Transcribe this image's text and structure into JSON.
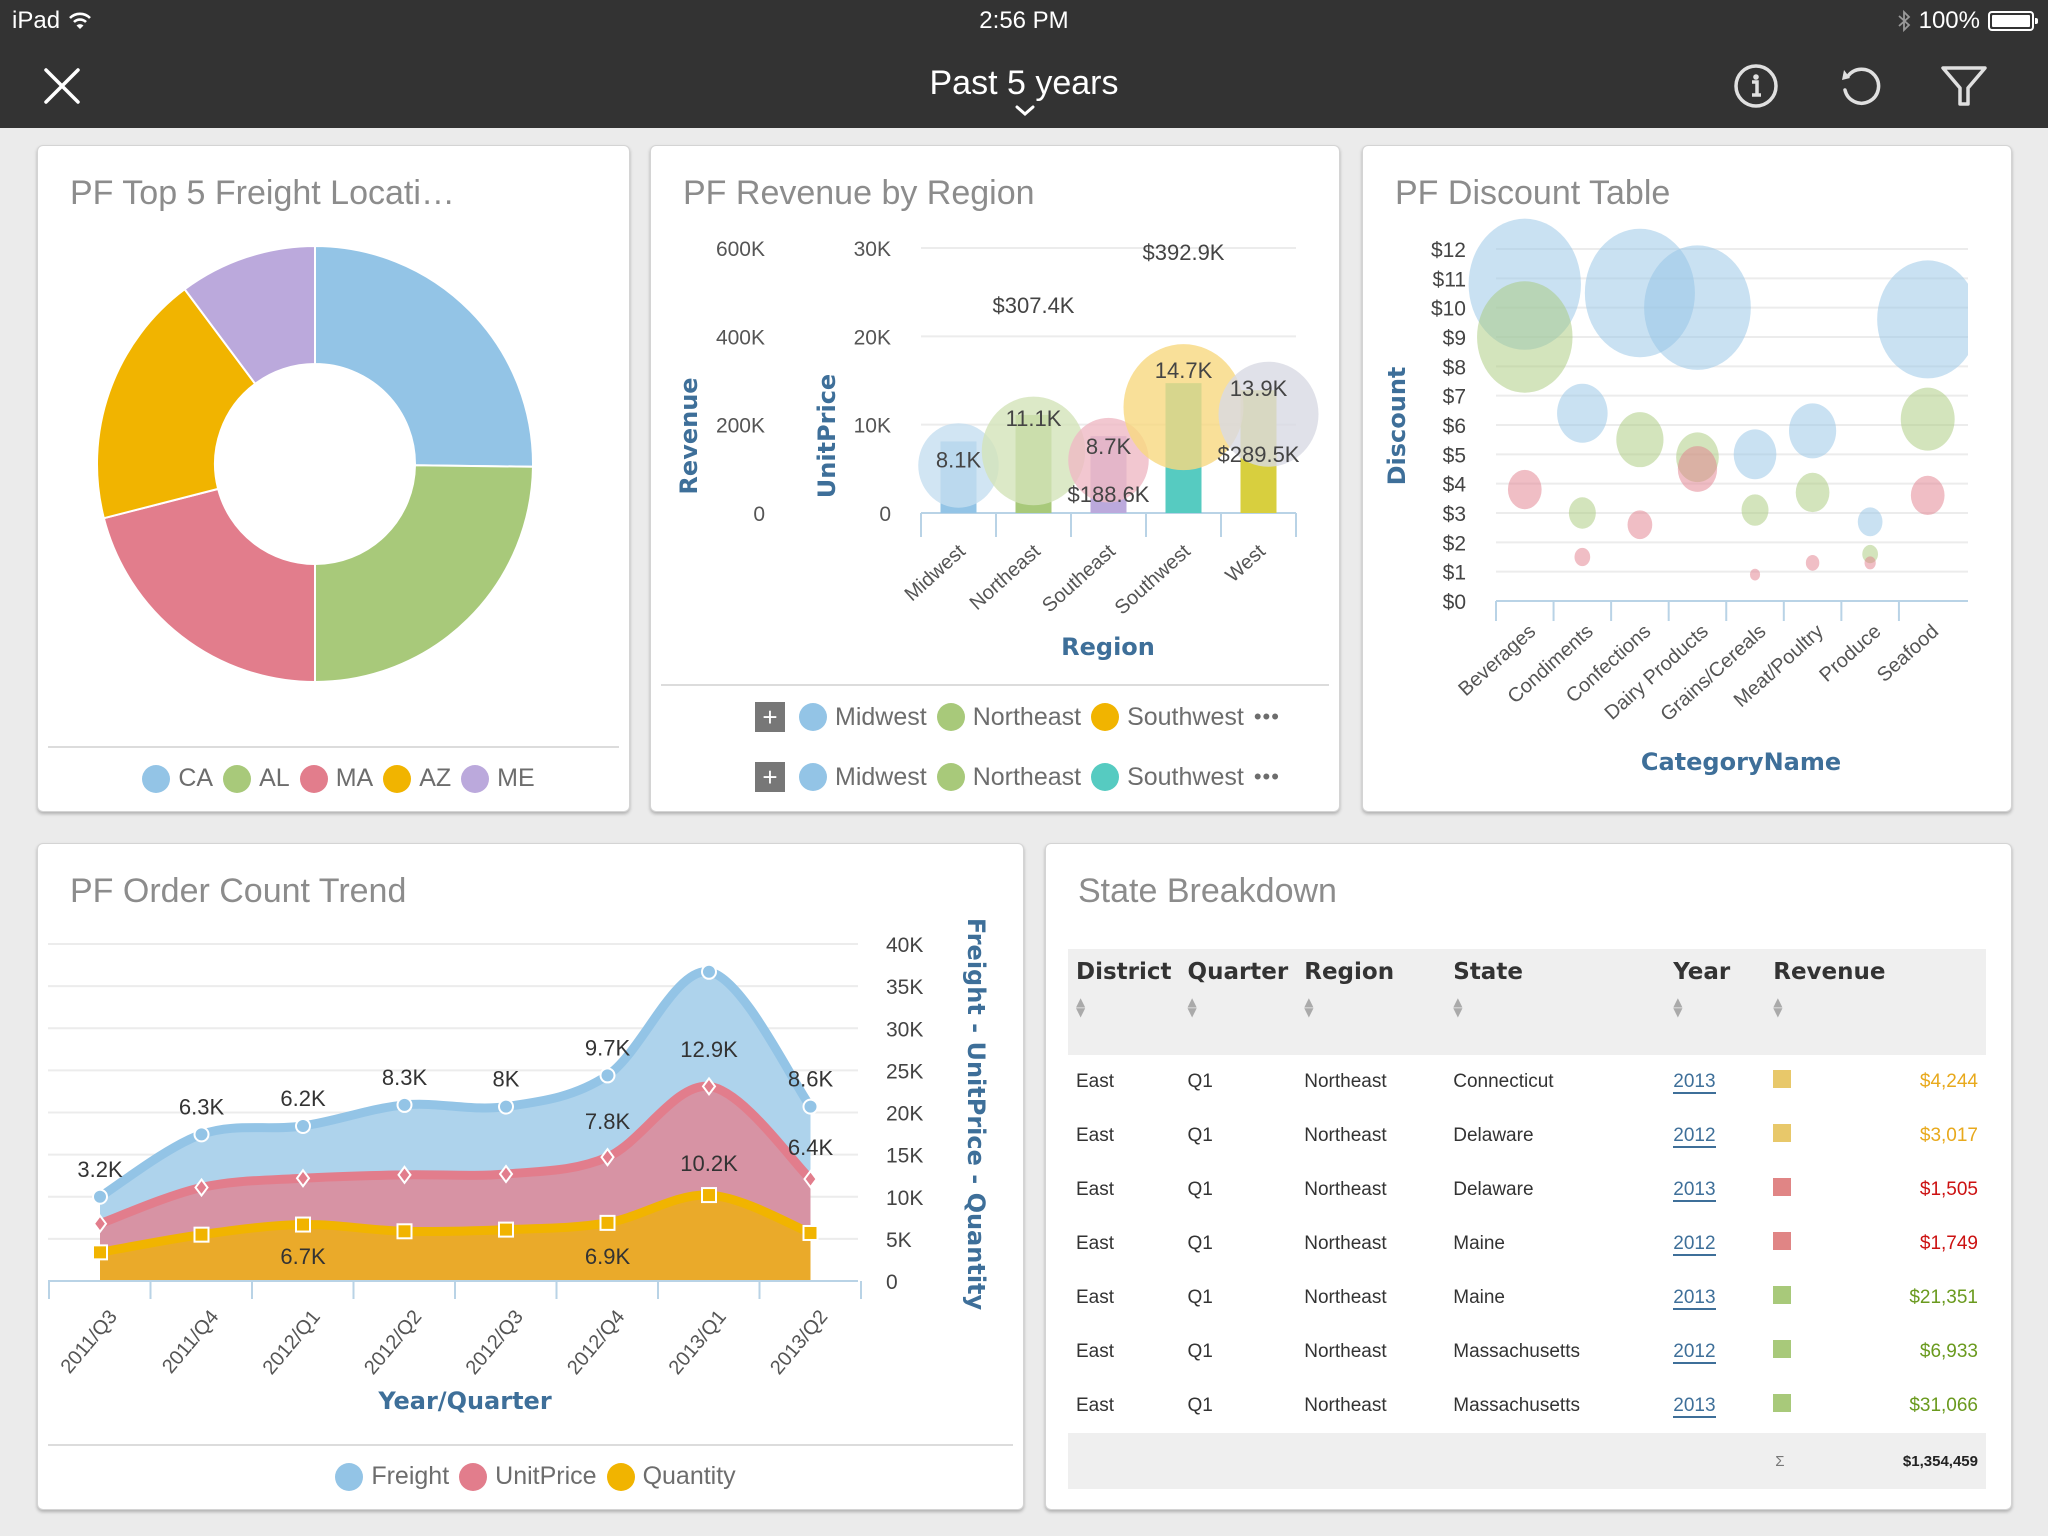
{
  "status_bar": {
    "device": "iPad",
    "time": "2:56 PM",
    "battery_percent": "100%",
    "battery_level": 1.0,
    "icons": [
      "wifi-icon",
      "bluetooth-icon",
      "battery-icon"
    ]
  },
  "nav": {
    "title": "Past 5 years",
    "icons": [
      "close-icon",
      "chevron-down-icon",
      "info-icon",
      "refresh-icon",
      "filter-icon"
    ]
  },
  "colors": {
    "blue": "#93c4e6",
    "green": "#a8c97a",
    "pink": "#e27d8c",
    "orange": "#f1b400",
    "purple": "#bba9dc",
    "teal": "#56cbc1",
    "olive": "#d8cf3e",
    "axis_title": "#3e6f99",
    "rev_orange": "#e8a91c",
    "rev_red": "#cc1111",
    "rev_green": "#6a9a1e"
  },
  "cards": {
    "freight": {
      "title": "PF Top 5 Freight Locati…",
      "legend": [
        {
          "label": "CA",
          "color": "#93c4e6"
        },
        {
          "label": "AL",
          "color": "#a8c97a"
        },
        {
          "label": "MA",
          "color": "#e27d8c"
        },
        {
          "label": "AZ",
          "color": "#f1b400"
        },
        {
          "label": "ME",
          "color": "#bba9dc"
        }
      ]
    },
    "revenue": {
      "title": "PF Revenue by Region",
      "legend_rows": [
        {
          "items": [
            {
              "label": "Midwest",
              "color": "#93c4e6"
            },
            {
              "label": "Northeast",
              "color": "#a8c97a"
            },
            {
              "label": "Southwest",
              "color": "#f1b400"
            }
          ],
          "more": "•••",
          "expand": "+"
        },
        {
          "items": [
            {
              "label": "Midwest",
              "color": "#93c4e6"
            },
            {
              "label": "Northeast",
              "color": "#a8c97a"
            },
            {
              "label": "Southwest",
              "color": "#56cbc1"
            }
          ],
          "more": "•••",
          "expand": "+"
        }
      ]
    },
    "discount": {
      "title": "PF Discount Table"
    },
    "order_trend": {
      "title": "PF Order Count Trend",
      "legend": [
        {
          "label": "Freight",
          "color": "#93c4e6"
        },
        {
          "label": "UnitPrice",
          "color": "#e27d8c"
        },
        {
          "label": "Quantity",
          "color": "#f1b400"
        }
      ]
    },
    "state": {
      "title": "State Breakdown",
      "columns": [
        "District",
        "Quarter",
        "Region",
        "State",
        "Year",
        "Revenue"
      ],
      "rows": [
        {
          "district": "East",
          "quarter": "Q1",
          "region": "Northeast",
          "state": "Connecticut",
          "year": "2013",
          "swatch": "#e8c86a",
          "revenue": "$4,244",
          "rev_color": "#e8a91c"
        },
        {
          "district": "East",
          "quarter": "Q1",
          "region": "Northeast",
          "state": "Delaware",
          "year": "2012",
          "swatch": "#e8c86a",
          "revenue": "$3,017",
          "rev_color": "#e8a91c"
        },
        {
          "district": "East",
          "quarter": "Q1",
          "region": "Northeast",
          "state": "Delaware",
          "year": "2013",
          "swatch": "#e08585",
          "revenue": "$1,505",
          "rev_color": "#cc1111"
        },
        {
          "district": "East",
          "quarter": "Q1",
          "region": "Northeast",
          "state": "Maine",
          "year": "2012",
          "swatch": "#e08585",
          "revenue": "$1,749",
          "rev_color": "#cc1111"
        },
        {
          "district": "East",
          "quarter": "Q1",
          "region": "Northeast",
          "state": "Maine",
          "year": "2013",
          "swatch": "#a8c97a",
          "revenue": "$21,351",
          "rev_color": "#6a9a1e"
        },
        {
          "district": "East",
          "quarter": "Q1",
          "region": "Northeast",
          "state": "Massachusetts",
          "year": "2012",
          "swatch": "#a8c97a",
          "revenue": "$6,933",
          "rev_color": "#6a9a1e"
        },
        {
          "district": "East",
          "quarter": "Q1",
          "region": "Northeast",
          "state": "Massachusetts",
          "year": "2013",
          "swatch": "#a8c97a",
          "revenue": "$31,066",
          "rev_color": "#6a9a1e"
        }
      ],
      "total_symbol": "Σ",
      "total": "$1,354,459"
    }
  },
  "chart_data": [
    {
      "id": "freight_donut",
      "type": "pie",
      "donut": true,
      "title": "PF Top 5 Freight Locati…",
      "categories": [
        "CA",
        "AL",
        "MA",
        "AZ",
        "ME"
      ],
      "values": [
        25.2,
        24.8,
        21.0,
        18.8,
        10.2
      ],
      "colors": [
        "#93c4e6",
        "#a8c97a",
        "#e27d8c",
        "#f1b400",
        "#bba9dc"
      ],
      "legend": "bottom"
    },
    {
      "id": "revenue_region",
      "type": "bar",
      "title": "PF Revenue by Region",
      "categories": [
        "Midwest",
        "Northeast",
        "Southeast",
        "Southwest",
        "West"
      ],
      "xlabel": "Region",
      "y_axes": [
        {
          "label": "Revenue",
          "ticks": [
            "0",
            "200K",
            "400K",
            "600K"
          ],
          "range": [
            0,
            600000
          ]
        },
        {
          "label": "UnitPrice",
          "ticks": [
            "0",
            "10K",
            "20K",
            "30K"
          ],
          "range": [
            0,
            30000
          ]
        }
      ],
      "series": [
        {
          "name": "UnitPrice (bars)",
          "values": [
            8100,
            11100,
            8700,
            14700,
            13900
          ],
          "labels": [
            "",
            "",
            "",
            "",
            ""
          ],
          "colors": [
            "#93c4e6",
            "#a8c97a",
            "#bba9dc",
            "#56cbc1",
            "#d8cf3e"
          ]
        },
        {
          "name": "Revenue (bubbles)",
          "values": [
            188600,
            307400,
            188600,
            392900,
            289500
          ],
          "bubble_values": [
            8100,
            11100,
            8700,
            14700,
            13900
          ],
          "bubble_labels": [
            "8.1K",
            "11.1K",
            "8.7K",
            "14.7K",
            "13.9K"
          ],
          "revenue_labels": [
            "",
            "$307.4K",
            "$188.6K",
            "$392.9K",
            "$289.5K"
          ],
          "colors": [
            "#c6dff0",
            "#d3e4b9",
            "#efb9c4",
            "#f7d880",
            "#d8dae4"
          ]
        }
      ],
      "legend": "bottom"
    },
    {
      "id": "discount_bubbles",
      "type": "scatter",
      "title": "PF Discount Table",
      "xlabel": "CategoryName",
      "ylabel": "Discount",
      "categories": [
        "Beverages",
        "Condiments",
        "Confections",
        "Dairy Products",
        "Grains/Cereals",
        "Meat/Poultry",
        "Produce",
        "Seafood"
      ],
      "y_ticks": [
        "$0",
        "$1",
        "$2",
        "$3",
        "$4",
        "$5",
        "$6",
        "$7",
        "$8",
        "$9",
        "$10",
        "$11",
        "$12"
      ],
      "ylim": [
        0,
        12
      ],
      "series": [
        {
          "name": "blue",
          "color": "#93c4e6",
          "points": [
            {
              "x": 0.5,
              "y": 10.8,
              "r": 1.0
            },
            {
              "x": 1.5,
              "y": 6.4,
              "r": 0.45
            },
            {
              "x": 2.5,
              "y": 10.5,
              "r": 0.98
            },
            {
              "x": 3.5,
              "y": 10.0,
              "r": 0.95
            },
            {
              "x": 4.5,
              "y": 5.0,
              "r": 0.38
            },
            {
              "x": 5.5,
              "y": 5.8,
              "r": 0.42
            },
            {
              "x": 6.5,
              "y": 2.7,
              "r": 0.22
            },
            {
              "x": 7.5,
              "y": 9.6,
              "r": 0.9
            }
          ]
        },
        {
          "name": "green",
          "color": "#a8c97a",
          "points": [
            {
              "x": 0.5,
              "y": 9.0,
              "r": 0.85
            },
            {
              "x": 1.5,
              "y": 3.0,
              "r": 0.24
            },
            {
              "x": 2.5,
              "y": 5.5,
              "r": 0.42
            },
            {
              "x": 3.5,
              "y": 4.9,
              "r": 0.38
            },
            {
              "x": 4.5,
              "y": 3.1,
              "r": 0.24
            },
            {
              "x": 5.5,
              "y": 3.7,
              "r": 0.3
            },
            {
              "x": 6.5,
              "y": 1.6,
              "r": 0.14
            },
            {
              "x": 7.5,
              "y": 6.2,
              "r": 0.48
            }
          ]
        },
        {
          "name": "pink",
          "color": "#e27d8c",
          "points": [
            {
              "x": 0.5,
              "y": 3.8,
              "r": 0.3
            },
            {
              "x": 1.5,
              "y": 1.5,
              "r": 0.14
            },
            {
              "x": 2.5,
              "y": 2.6,
              "r": 0.22
            },
            {
              "x": 3.5,
              "y": 4.5,
              "r": 0.35
            },
            {
              "x": 4.5,
              "y": 0.9,
              "r": 0.09
            },
            {
              "x": 5.5,
              "y": 1.3,
              "r": 0.12
            },
            {
              "x": 6.5,
              "y": 1.3,
              "r": 0.1
            },
            {
              "x": 7.5,
              "y": 3.6,
              "r": 0.3
            }
          ]
        }
      ]
    },
    {
      "id": "order_trend",
      "type": "area",
      "stacked": true,
      "title": "PF Order Count Trend",
      "xlabel": "Year/Quarter",
      "ylabel": "Freight - UnitPrice - Quantity",
      "categories": [
        "2011/Q3",
        "2011/Q4",
        "2012/Q1",
        "2012/Q2",
        "2012/Q3",
        "2012/Q4",
        "2013/Q1",
        "2013/Q2"
      ],
      "ylim": [
        0,
        40000
      ],
      "y_ticks": [
        "0",
        "5K",
        "10K",
        "15K",
        "20K",
        "25K",
        "30K",
        "35K",
        "40K"
      ],
      "series": [
        {
          "name": "Quantity",
          "color": "#f1b400",
          "fill": "#eaaa2a",
          "marker": "square",
          "values": [
            3400,
            5500,
            6700,
            5900,
            6100,
            6900,
            10200,
            5700
          ],
          "labels": [
            "",
            "",
            "6.7K",
            "",
            "",
            "6.9K",
            "10.2K",
            ""
          ]
        },
        {
          "name": "UnitPrice",
          "color": "#e27d8c",
          "fill": "#d793a4",
          "marker": "diamond",
          "values": [
            3400,
            5600,
            5500,
            6700,
            6600,
            7800,
            12900,
            6400
          ],
          "labels": [
            "",
            "",
            "",
            "",
            "",
            "7.8K",
            "12.9K",
            "6.4K"
          ]
        },
        {
          "name": "Freight",
          "color": "#93c4e6",
          "fill": "#aed3ec",
          "marker": "circle",
          "values": [
            3200,
            6300,
            6200,
            8300,
            8000,
            9700,
            13600,
            8600
          ],
          "labels": [
            "3.2K",
            "6.3K",
            "6.2K",
            "8.3K",
            "8K",
            "9.7K",
            "",
            "8.6K"
          ]
        }
      ],
      "legend": "bottom"
    }
  ]
}
